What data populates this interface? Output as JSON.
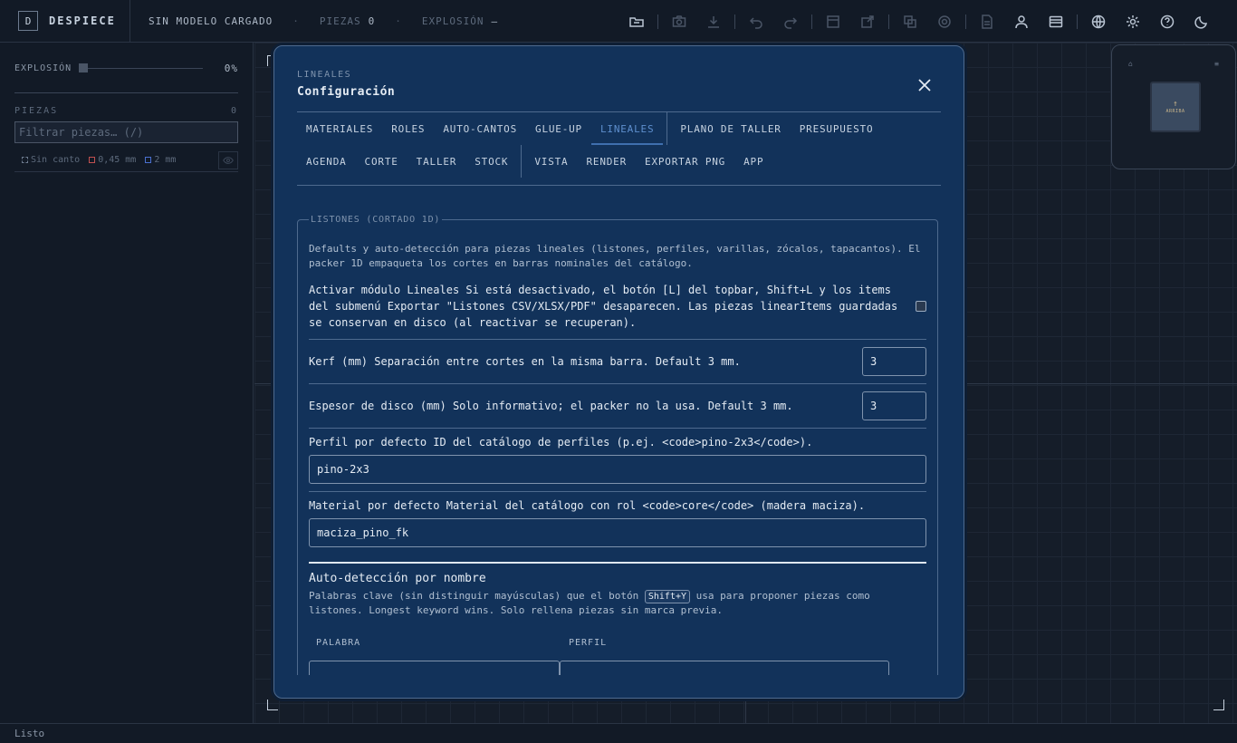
{
  "app": {
    "brand_letter": "D",
    "brand_name": "DESPIECE"
  },
  "topbar": {
    "model_status": "SIN MODELO CARGADO",
    "separator": "·",
    "pieces_label": "PIEZAS",
    "pieces_value": "0",
    "explosion_label": "EXPLOSIÓN",
    "explosion_value": "—"
  },
  "sidebar": {
    "explosion_label": "EXPLOSIÓN",
    "explosion_value": "0%",
    "explosion_level": 0,
    "pieces_label": "PIEZAS",
    "pieces_count": "0",
    "filter_placeholder": "Filtrar piezas…  (/)",
    "legend": {
      "no_edge": "Sin canto",
      "edge_1": "0,45 mm",
      "edge_2": "2 mm"
    }
  },
  "navcube": {
    "arrow": "↑",
    "face_label": "ARRIBA"
  },
  "statusbar": {
    "text": "Listo"
  },
  "modal": {
    "kicker": "LINEALES",
    "title": "Configuración",
    "tabs_row1": [
      "MATERIALES",
      "ROLES",
      "AUTO-CANTOS",
      "GLUE-UP",
      "LINEALES",
      "PLANO DE TALLER",
      "PRESUPUESTO"
    ],
    "tabs_row2": [
      "AGENDA",
      "CORTE",
      "TALLER",
      "STOCK",
      "VISTA",
      "RENDER",
      "EXPORTAR PNG",
      "APP"
    ],
    "active_tab": "LINEALES",
    "section_legend": "LISTONES (CORTADO 1D)",
    "section_desc": "Defaults y auto-detección para piezas lineales (listones, perfiles, varillas, zócalos, tapacantos). El packer 1D empaqueta los cortes en barras nominales del catálogo.",
    "enable_label": "Activar módulo Lineales Si está desactivado, el botón [L] del topbar, Shift+L y los items del submenú Exportar \"Listones CSV/XLSX/PDF\" desaparecen. Las piezas linearItems guardadas se conservan en disco (al reactivar se recuperan).",
    "kerf_label": "Kerf (mm) Separación entre cortes en la misma barra. Default 3 mm.",
    "kerf_value": "3",
    "disk_label": "Espesor de disco (mm) Solo informativo; el packer no la usa. Default 3 mm.",
    "disk_value": "3",
    "profile_label": "Perfil por defecto ID del catálogo de perfiles (p.ej. <code>pino-2x3</code>).",
    "profile_value": "pino-2x3",
    "material_label": "Material por defecto Material del catálogo con rol <code>core</code> (madera maciza).",
    "material_value": "maciza_pino_fk",
    "auto_title": "Auto-detección por nombre",
    "auto_desc_1": "Palabras clave (sin distinguir mayúsculas) que el botón",
    "auto_kbd": "Shift+Y",
    "auto_desc_2": "usa para proponer piezas como listones. Longest keyword wins. Solo rellena piezas sin marca previa.",
    "col_word": "PALABRA",
    "col_profile": "PERFIL"
  },
  "colors": {
    "accent": "#3f6fae",
    "modal_bg": "#12325a",
    "app_bg": "#121a26"
  }
}
